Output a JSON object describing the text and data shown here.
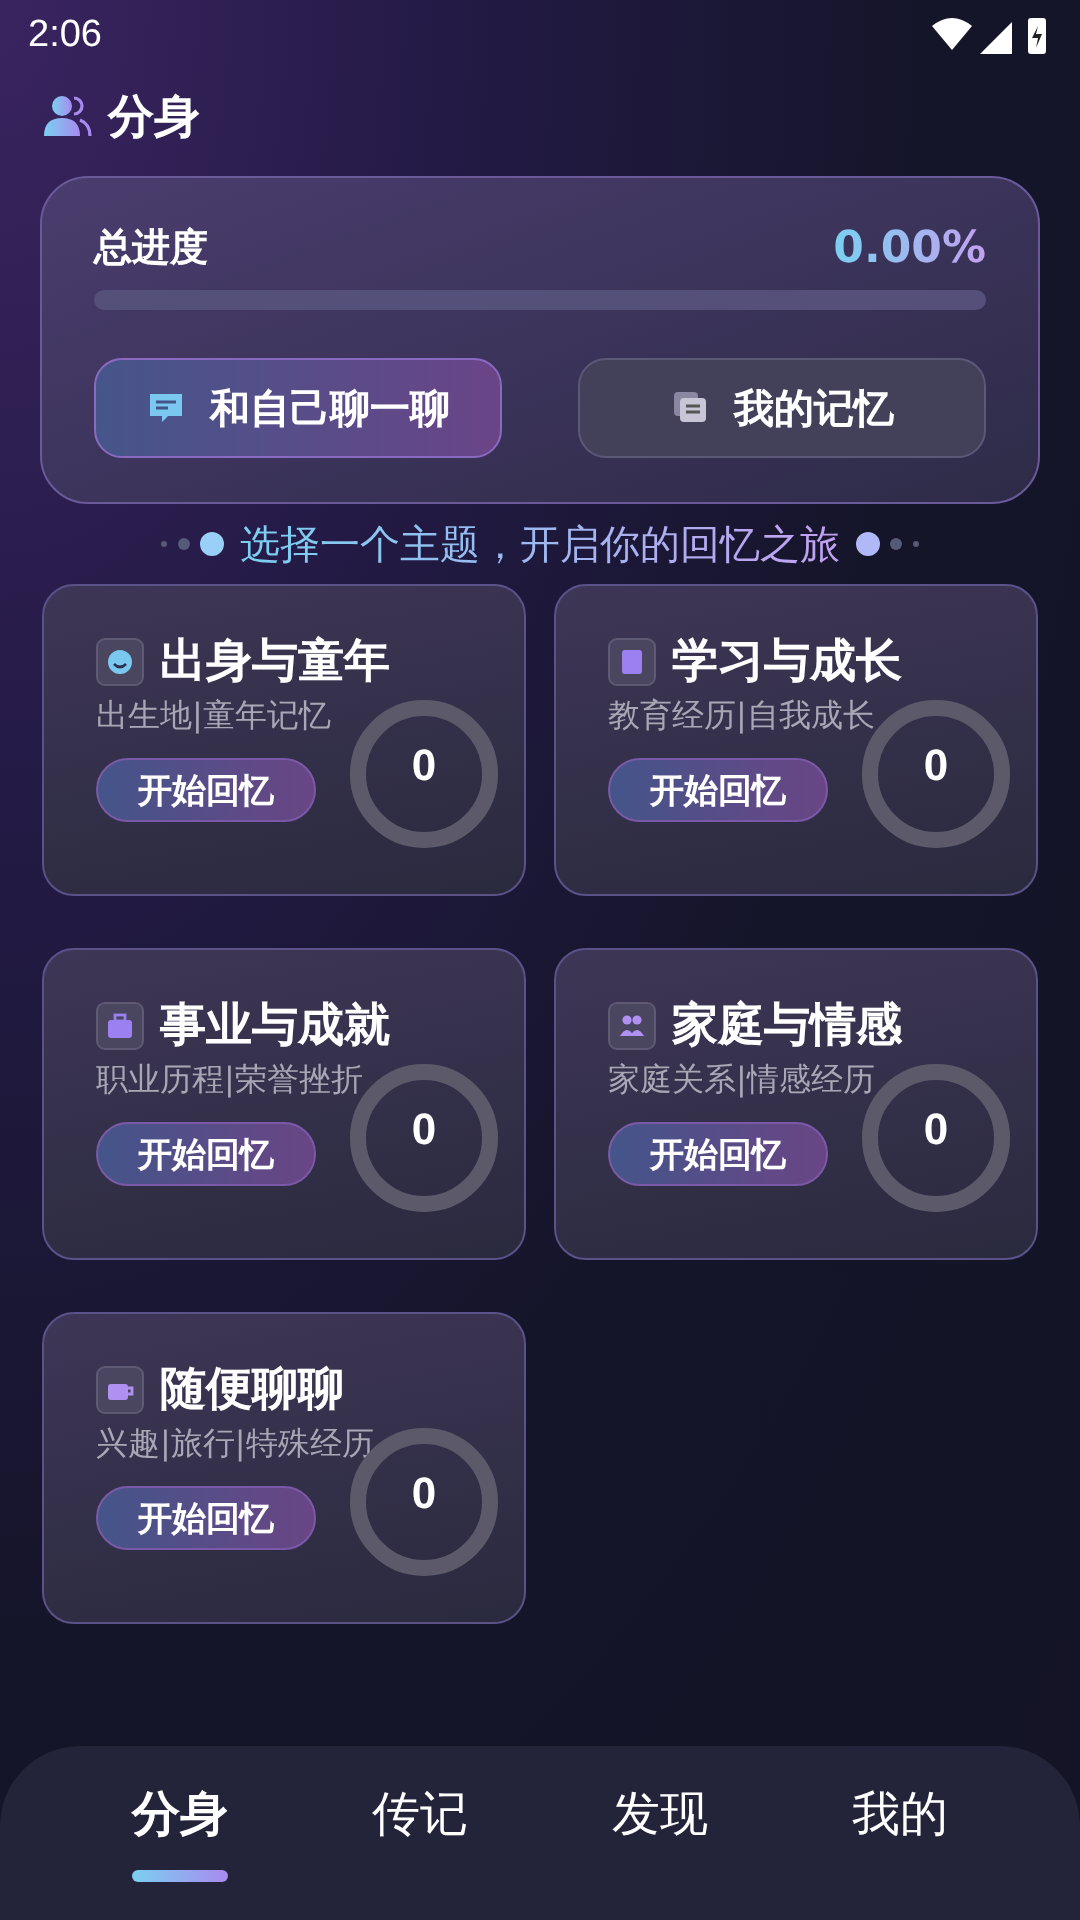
{
  "status_bar": {
    "time": "2:06"
  },
  "header": {
    "title": "分身"
  },
  "progress": {
    "label": "总进度",
    "value": "0.00%",
    "level": 0
  },
  "actions": [
    {
      "label": "和自己聊一聊",
      "kind": "primary"
    },
    {
      "label": "我的记忆",
      "kind": "secondary"
    }
  ],
  "tagline": "选择一个主题，开启你的回忆之旅",
  "topics": [
    {
      "title": "出身与童年",
      "subtitle": "出生地|童年记忆",
      "button": "开始回忆",
      "count": "0"
    },
    {
      "title": "学习与成长",
      "subtitle": "教育经历|自我成长",
      "button": "开始回忆",
      "count": "0"
    },
    {
      "title": "事业与成就",
      "subtitle": "职业历程|荣誉挫折",
      "button": "开始回忆",
      "count": "0"
    },
    {
      "title": "家庭与情感",
      "subtitle": "家庭关系|情感经历",
      "button": "开始回忆",
      "count": "0"
    },
    {
      "title": "随便聊聊",
      "subtitle": "兴趣|旅行|特殊经历",
      "button": "开始回忆",
      "count": "0"
    }
  ],
  "nav": [
    {
      "label": "分身",
      "selected": true
    },
    {
      "label": "传记",
      "selected": false
    },
    {
      "label": "发现",
      "selected": false
    },
    {
      "label": "我的",
      "selected": false
    }
  ]
}
